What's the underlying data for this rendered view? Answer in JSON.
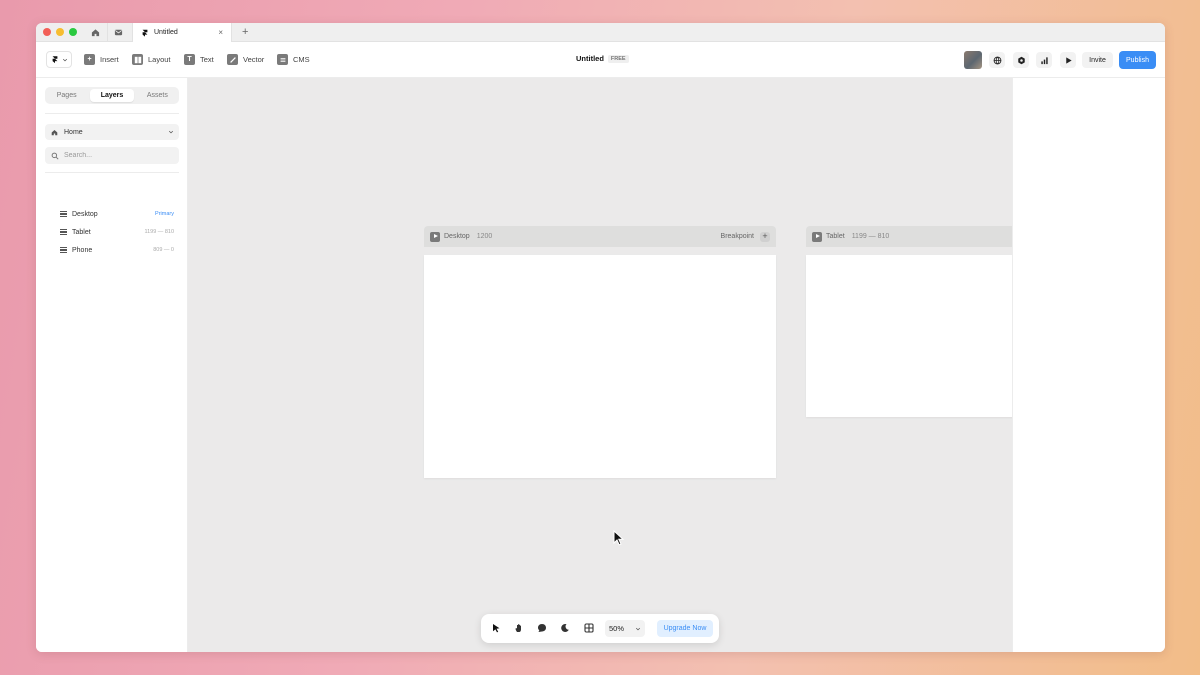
{
  "titlebar": {
    "tab_title": "Untitled",
    "tab_close": "×",
    "new_tab": "+"
  },
  "toolbar": {
    "items": [
      {
        "label": "Insert",
        "icon": "plus-icon"
      },
      {
        "label": "Layout",
        "icon": "layout-icon"
      },
      {
        "label": "Text",
        "icon": "text-icon"
      },
      {
        "label": "Vector",
        "icon": "vector-icon"
      },
      {
        "label": "CMS",
        "icon": "cms-icon"
      }
    ],
    "doc_title": "Untitled",
    "plan_badge": "FREE",
    "invite_label": "Invite",
    "publish_label": "Publish",
    "publish_color": "#3a8df5"
  },
  "sidebar": {
    "tabs": [
      "Pages",
      "Layers",
      "Assets"
    ],
    "active_tab": "Layers",
    "page": "Home",
    "search_placeholder": "Search...",
    "layers": [
      {
        "name": "Desktop",
        "meta": "Primary"
      },
      {
        "name": "Tablet",
        "meta": "1199 — 810"
      },
      {
        "name": "Phone",
        "meta": "809 — 0"
      }
    ]
  },
  "canvas": {
    "desktop": {
      "label": "Desktop",
      "size": "1200",
      "breakpoint_label": "Breakpoint"
    },
    "tablet": {
      "label": "Tablet",
      "size": "1199 — 810"
    }
  },
  "bottom_bar": {
    "zoom": "50%",
    "upgrade_label": "Upgrade Now"
  }
}
